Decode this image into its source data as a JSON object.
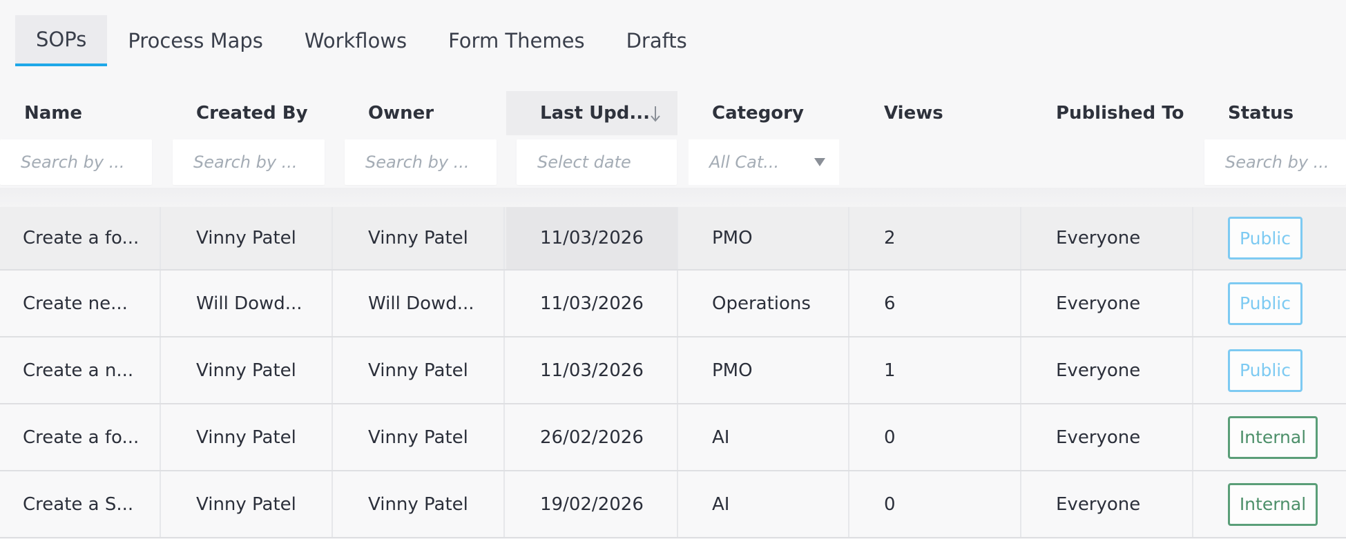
{
  "tabs": [
    {
      "label": "SOPs",
      "active": true
    },
    {
      "label": "Process Maps",
      "active": false
    },
    {
      "label": "Workflows",
      "active": false
    },
    {
      "label": "Form Themes",
      "active": false
    },
    {
      "label": "Drafts",
      "active": false
    }
  ],
  "columns": {
    "name": "Name",
    "created_by": "Created By",
    "owner": "Owner",
    "last_updated": "Last Upd...",
    "category": "Category",
    "views": "Views",
    "published_to": "Published To",
    "status": "Status"
  },
  "filters": {
    "name_placeholder": "Search by ...",
    "created_by_placeholder": "Search by ...",
    "owner_placeholder": "Search by ...",
    "date_placeholder": "Select date",
    "category_selected": "All Cat...",
    "status_placeholder": "Search by ..."
  },
  "icons": {
    "sort": "arrow-down-icon",
    "dropdown": "caret-down-icon"
  },
  "colors": {
    "accent": "#1ea7e8",
    "public_badge": "#7dcaf2",
    "internal_badge": "#5a9e78"
  },
  "rows": [
    {
      "name": "Create a fo...",
      "created_by": "Vinny Patel",
      "owner": "Vinny Patel",
      "last_updated": "11/03/2026",
      "category": "PMO",
      "views": "2",
      "published_to": "Everyone",
      "status": "Public"
    },
    {
      "name": "Create ne...",
      "created_by": "Will Dowd...",
      "owner": "Will Dowd...",
      "last_updated": "11/03/2026",
      "category": "Operations",
      "views": "6",
      "published_to": "Everyone",
      "status": "Public"
    },
    {
      "name": "Create a n...",
      "created_by": "Vinny Patel",
      "owner": "Vinny Patel",
      "last_updated": "11/03/2026",
      "category": "PMO",
      "views": "1",
      "published_to": "Everyone",
      "status": "Public"
    },
    {
      "name": "Create a fo...",
      "created_by": "Vinny Patel",
      "owner": "Vinny Patel",
      "last_updated": "26/02/2026",
      "category": "AI",
      "views": "0",
      "published_to": "Everyone",
      "status": "Internal"
    },
    {
      "name": "Create a S...",
      "created_by": "Vinny Patel",
      "owner": "Vinny Patel",
      "last_updated": "19/02/2026",
      "category": "AI",
      "views": "0",
      "published_to": "Everyone",
      "status": "Internal"
    }
  ]
}
